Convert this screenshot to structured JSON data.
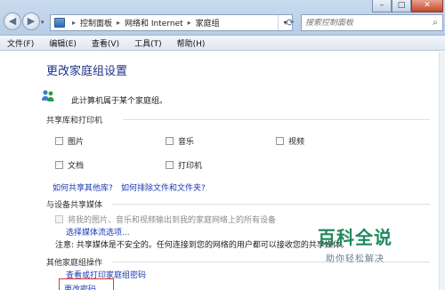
{
  "window": {
    "min_label": "–",
    "max_label": "□",
    "close_label": "✕"
  },
  "nav": {
    "back_label": "◀",
    "forward_label": "▶",
    "drop_label": "▾"
  },
  "address": {
    "crumbs": [
      "控制面板",
      "网络和 Internet",
      "家庭组"
    ],
    "separator": "▸",
    "drop_label": "▾"
  },
  "refresh_label": "⟳",
  "search": {
    "placeholder": "搜索控制面板",
    "icon_label": "⌕"
  },
  "menu": [
    "文件(F)",
    "编辑(E)",
    "查看(V)",
    "工具(T)",
    "帮助(H)"
  ],
  "page": {
    "title": "更改家庭组设置",
    "homegroup_status": "此计算机属于某个家庭组。",
    "section_libraries": "共享库和打印机",
    "libraries": [
      {
        "label": "图片",
        "checked": false
      },
      {
        "label": "音乐",
        "checked": false
      },
      {
        "label": "视频",
        "checked": false
      },
      {
        "label": "文档",
        "checked": false
      },
      {
        "label": "打印机",
        "checked": false
      }
    ],
    "link_share_other": "如何共享其他库?",
    "link_exclude": "如何排除文件和文件夹?",
    "section_media": "与设备共享媒体",
    "media_stream_label": "将我的图片、音乐和视频输出到我的家庭网络上的所有设备",
    "link_media_options": "选择媒体流选项...",
    "note_media": "注意: 共享媒体是不安全的。任何连接到您的网络的用户都可以接收您的共享媒体。",
    "section_other": "其他家庭组操作",
    "link_view_password": "查看或打印家庭组密码",
    "link_change_password": "更改密码..."
  },
  "watermark": {
    "top": "百科全说",
    "bottom": "助你轻松解决"
  },
  "colors": {
    "accent_title": "#1e3287",
    "link": "#1a3ab3",
    "highlight_box": "#e0352b",
    "watermark_green": "#1f8a5e"
  }
}
